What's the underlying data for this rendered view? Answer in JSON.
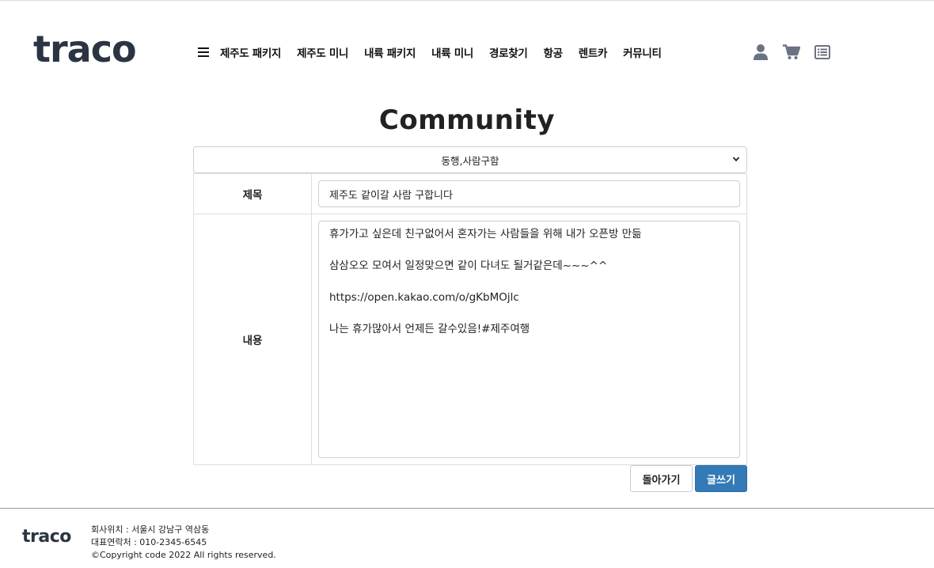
{
  "header": {
    "logo": "traco",
    "nav": [
      "제주도 패키지",
      "제주도 미니",
      "내륙 패키지",
      "내륙 미니",
      "경로찾기",
      "항공",
      "렌트카",
      "커뮤니티"
    ],
    "icons": [
      "user-icon",
      "cart-icon",
      "list-icon"
    ],
    "icon_color": "#6b7280"
  },
  "page": {
    "title": "Community"
  },
  "form": {
    "category_selected": "동행,사람구함",
    "title_label": "제목",
    "title_value": "제주도 같이갈 사람 구합니다",
    "content_label": "내용",
    "content_lines": [
      "휴가가고 싶은데 친구없어서 혼자가는 사람들을 위해 내가 오픈방 만듦",
      "삼삼오오 모여서 일정맞으면 같이 다녀도 될거같은데~~~^^",
      "https://open.kakao.com/o/gKbMOjlc",
      "나는 휴가많아서 언제든 갈수있음!#제주여행"
    ]
  },
  "buttons": {
    "back": "돌아가기",
    "write": "글쓰기",
    "write_color": "#337ab7"
  },
  "footer": {
    "logo": "traco",
    "address": "회사위치 : 서울시 강남구 역삼동",
    "phone": "대표연락처 : 010-2345-6545",
    "copyright": "©Copyright code 2022 All rights reserved."
  }
}
